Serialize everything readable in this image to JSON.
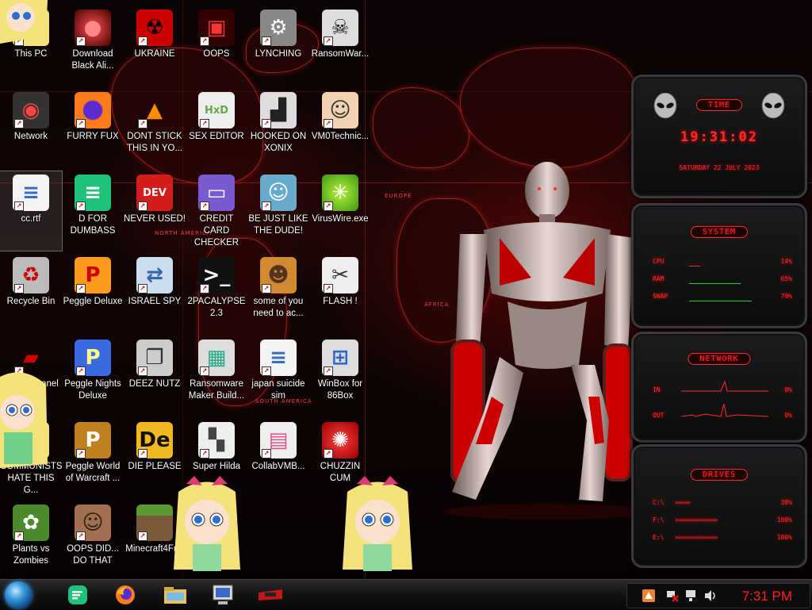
{
  "desktop": {
    "map_labels": [
      "NORTH AMERICA",
      "EUROPE",
      "AFRICA",
      "SOUTH AMERICA"
    ],
    "icons": [
      {
        "label": "This PC",
        "icon": "star-cartoon-icon"
      },
      {
        "label": "Download Black Ali...",
        "icon": "alien-orb-icon"
      },
      {
        "label": "UKRAINE",
        "icon": "radiation-icon"
      },
      {
        "label": "OOPS",
        "icon": "red-window-icon"
      },
      {
        "label": "LYNCHING",
        "icon": "gear-figure-icon"
      },
      {
        "label": "RansomWar...",
        "icon": "skull-icon"
      },
      {
        "label": "Network",
        "icon": "alien-network-icon"
      },
      {
        "label": "FURRY FUX",
        "icon": "firefox-icon"
      },
      {
        "label": "DONT STICK THIS IN YO...",
        "icon": "vlc-cone-icon"
      },
      {
        "label": "SEX EDITOR",
        "icon": "hxd-icon"
      },
      {
        "label": "HOOKED ON XONIX",
        "icon": "xonix-icon"
      },
      {
        "label": "VM0Technic...",
        "icon": "doctor-icon"
      },
      {
        "label": "cc.rtf",
        "icon": "document-icon"
      },
      {
        "label": "D FOR DUMBASS",
        "icon": "messenger-icon"
      },
      {
        "label": "NEVER USED!",
        "icon": "devcpp-icon"
      },
      {
        "label": "CREDIT CARD CHECKER",
        "icon": "credit-card-icon"
      },
      {
        "label": "BE JUST LIKE THE DUDE!",
        "icon": "dude-icon"
      },
      {
        "label": "VirusWire.exe",
        "icon": "lime-icon"
      },
      {
        "label": "Recycle Bin",
        "icon": "recycle-bin-icon"
      },
      {
        "label": "Peggle Deluxe",
        "icon": "peggle-icon"
      },
      {
        "label": "ISRAEL SPY",
        "icon": "network-pc-icon"
      },
      {
        "label": "2PACALYPSE 2.3",
        "icon": "terminal-icon"
      },
      {
        "label": "some of you need to ac...",
        "icon": "beaver-icon"
      },
      {
        "label": "FLASH !",
        "icon": "flash-icon"
      },
      {
        "label": "Control Panel",
        "icon": "control-panel-icon"
      },
      {
        "label": "Peggle Nights Deluxe",
        "icon": "peggle-nights-icon"
      },
      {
        "label": "DEEZ NUTZ",
        "icon": "windows-stack-icon"
      },
      {
        "label": "Ransomware Maker Build...",
        "icon": "ransomware-maker-icon"
      },
      {
        "label": "japan suicide sim",
        "icon": "document-icon"
      },
      {
        "label": "WinBox for 86Box",
        "icon": "winbox-icon"
      },
      {
        "label": "COMMUNISTS HATE THIS G...",
        "icon": "star-cartoon-icon"
      },
      {
        "label": "Peggle World of Warcraft ...",
        "icon": "peggle-wow-icon"
      },
      {
        "label": "DIE PLEASE",
        "icon": "die-icon"
      },
      {
        "label": "Super Hilda",
        "icon": "pixel-dog-icon"
      },
      {
        "label": "CollabVMB...",
        "icon": "pink-monitor-icon"
      },
      {
        "label": "CHUZZIN CUM",
        "icon": "chuzzle-icon"
      },
      {
        "label": "Plants vs Zombies",
        "icon": "pvz-icon"
      },
      {
        "label": "OOPS DID... DO THAT",
        "icon": "portrait-icon"
      },
      {
        "label": "Minecraft4Fr...",
        "icon": "grass-block-icon"
      }
    ]
  },
  "widgets": {
    "time": {
      "title": "TIME",
      "clock": "19:31:02",
      "date": "SATURDAY 22 JULY 2023"
    },
    "system": {
      "title": "SYSTEM",
      "rows": [
        {
          "label": "CPU",
          "value": "14%",
          "level": 0.14
        },
        {
          "label": "RAM",
          "value": "65%",
          "level": 0.65
        },
        {
          "label": "SWAP",
          "value": "79%",
          "level": 0.79
        }
      ]
    },
    "network": {
      "title": "NETWORK",
      "rows": [
        {
          "label": "IN",
          "value": "0%"
        },
        {
          "label": "OUT",
          "value": "0%"
        }
      ]
    },
    "drives": {
      "title": "DRIVES",
      "rows": [
        {
          "label": "C:\\",
          "value": "38%",
          "level": 0.38
        },
        {
          "label": "F:\\",
          "value": "100%",
          "level": 1.0
        },
        {
          "label": "E:\\",
          "value": "100%",
          "level": 1.0
        }
      ]
    }
  },
  "taskbar": {
    "start_icon": "start-orb-icon",
    "pinned": [
      "messenger-icon",
      "firefox-icon",
      "file-explorer-icon",
      "computer-icon",
      "control-panel-icon"
    ],
    "tray_icons": [
      "app-icon",
      "network-error-icon",
      "network-icon",
      "volume-icon"
    ],
    "clock": "7:31 PM"
  },
  "colors": {
    "accent": "#ff2020",
    "panel": "#1b1b1d",
    "taskbar": "#121212"
  }
}
